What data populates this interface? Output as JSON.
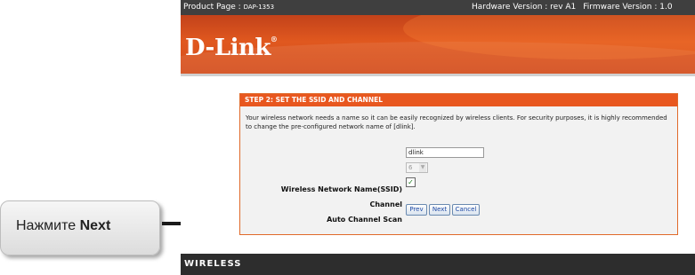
{
  "callout": {
    "prefix": "Нажмите ",
    "bold": "Next"
  },
  "topbar": {
    "product_label": "Product Page : ",
    "product_model": "DAP-1353",
    "hardware": "Hardware Version : rev A1",
    "firmware": "Firmware Version : 1.0"
  },
  "brand": {
    "logo": "D-Link",
    "mark": "®"
  },
  "panel": {
    "title": "STEP 2: SET THE SSID AND CHANNEL",
    "description": "Your wireless network needs a name so it can be easily recognized by wireless clients. For security purposes, it is highly recommended to change the pre-configured network name of [dlink]."
  },
  "form": {
    "ssid_label": "Wireless Network Name(SSID)",
    "ssid_value": "dlink",
    "channel_label": "Channel",
    "channel_value": "6",
    "auto_scan_label": "Auto Channel Scan",
    "auto_scan_checked": true
  },
  "buttons": {
    "prev": "Prev",
    "next": "Next",
    "cancel": "Cancel"
  },
  "footer": {
    "label": "WIRELESS"
  },
  "colors": {
    "accent": "#e8571f",
    "header": "#d34d1c",
    "topbar": "#3f3f3f",
    "footer": "#2d2d2d"
  }
}
